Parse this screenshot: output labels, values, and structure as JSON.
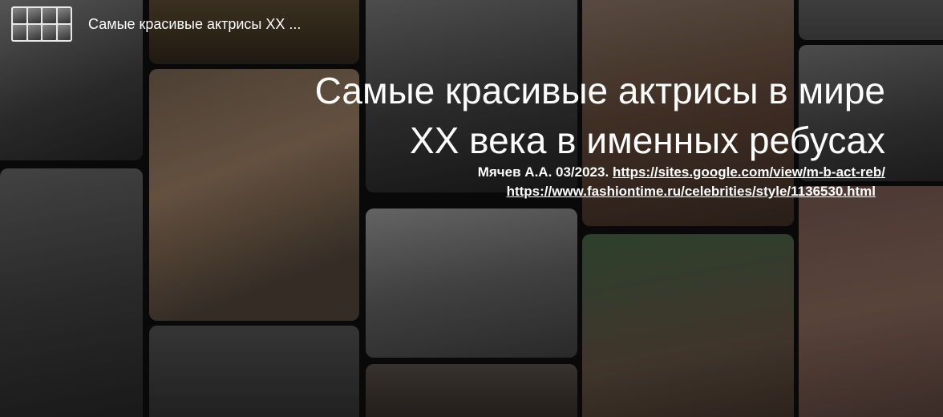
{
  "header": {
    "title": "Самые красивые актрисы XX ..."
  },
  "slide": {
    "title_line1": "Самые красивые актрисы в мире",
    "title_line2": "XX века в именных ребусах",
    "author": "Мячев А.А. 03/2023.",
    "link1": "https://sites.google.com/view/m-b-act-reb/",
    "link2": "https://www.fashiontime.ru/celebrities/style/1136530.html"
  }
}
